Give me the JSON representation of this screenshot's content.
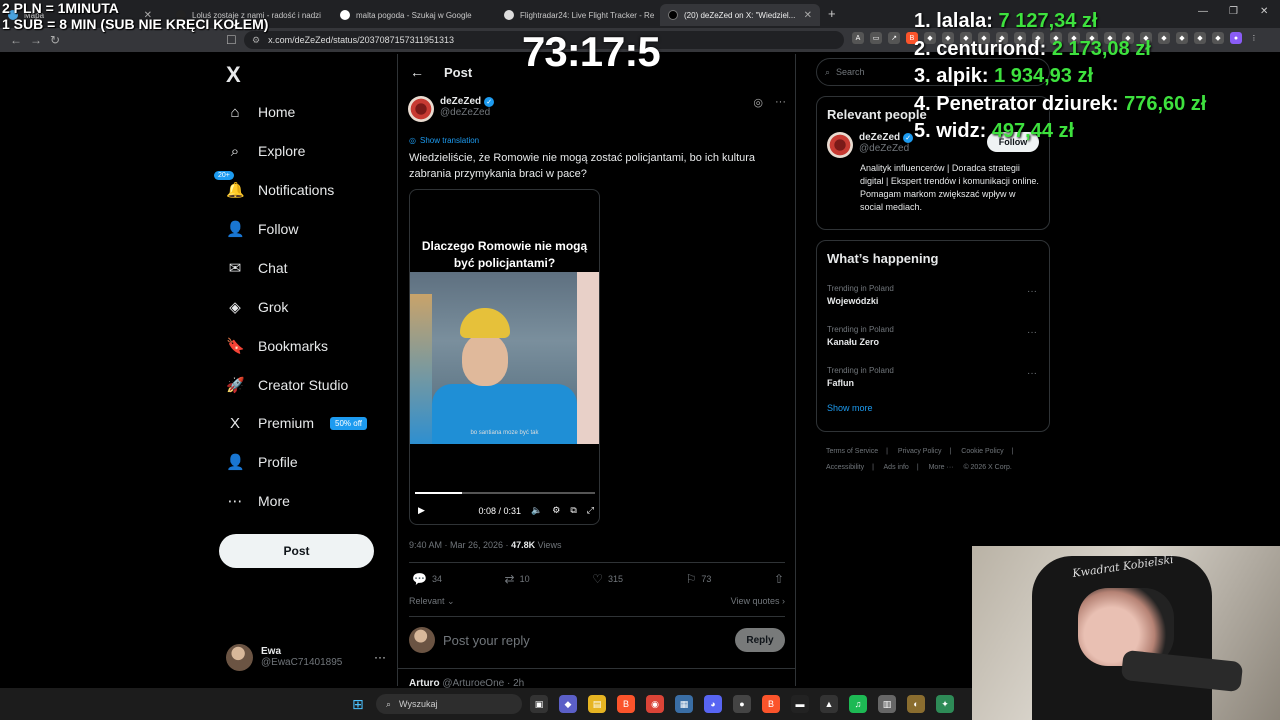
{
  "browser": {
    "tabs": [
      {
        "label": "Mapa",
        "color": "#4aa3df"
      },
      {
        "label": "Loluś zostaje z nami - radość i nadzi",
        "color": "#111111"
      },
      {
        "label": "malta pogoda - Szukaj w Google",
        "color": "#ffffff"
      },
      {
        "label": "Flightradar24: Live Flight Tracker - Re",
        "color": "#dddddd"
      },
      {
        "label": "(20) deZeZed on X: \"Wiedziel...",
        "color": "#000000"
      }
    ],
    "new_tab": "+",
    "url": "x.com/deZeZed/status/2037087157311951313"
  },
  "overlay": {
    "line1": "2 PLN = 1MINUTA",
    "line2": "1 SUB = 8 MIN (SUB NIE KRĘCI KOŁEM)",
    "timer": "73:17:5",
    "leaderboard": [
      {
        "rank": "1.",
        "name": "lalala:",
        "amount": "7 127,34 zł"
      },
      {
        "rank": "2.",
        "name": "centuriond:",
        "amount": "2 173,08 zł"
      },
      {
        "rank": "3.",
        "name": "alpik:",
        "amount": "1 934,93 zł"
      },
      {
        "rank": "4.",
        "name": "Penetrator dziurek:",
        "amount": "776,60 zł"
      },
      {
        "rank": "5.",
        "name": "widz:",
        "amount": "497,44 zł"
      }
    ],
    "webcam_shirt_text": "Kwadrat Kobielski"
  },
  "sidebar": {
    "logo": "X",
    "items": [
      {
        "label": "Home",
        "icon": "⌂"
      },
      {
        "label": "Explore",
        "icon": "⌕"
      },
      {
        "label": "Notifications",
        "icon": "🔔",
        "badge": "20+"
      },
      {
        "label": "Follow",
        "icon": "👤"
      },
      {
        "label": "Chat",
        "icon": "✉"
      },
      {
        "label": "Grok",
        "icon": "◈"
      },
      {
        "label": "Bookmarks",
        "icon": "🔖"
      },
      {
        "label": "Creator Studio",
        "icon": "🚀"
      },
      {
        "label": "Premium",
        "icon": "X",
        "badge": "50% off"
      },
      {
        "label": "Profile",
        "icon": "👤"
      },
      {
        "label": "More",
        "icon": "⋯"
      }
    ],
    "post_button": "Post",
    "account": {
      "name": "Ewa",
      "handle": "@EwaC71401895",
      "more": "···"
    }
  },
  "main": {
    "header": "Post",
    "author": {
      "name": "deZeZed",
      "handle": "@deZeZed"
    },
    "show_translation": "Show translation",
    "text": "Wiedzieliście, że Romowie nie mogą zostać policjantami, bo ich kultura zabrania przymykania braci w pace?",
    "video": {
      "title": "Dlaczego Romowie nie mogą być policjantami?",
      "subtitle": "bo santiana moze być tak",
      "time": "0:08 / 0:31",
      "progress": 0.26
    },
    "meta": {
      "time": "9:40 AM · Mar 26, 2026 · ",
      "views": "47.8K",
      "views_label": " Views"
    },
    "stats": {
      "replies": "34",
      "reposts": "10",
      "likes": "315",
      "bookmarks": "73"
    },
    "sort": "Relevant",
    "view_quotes": "View quotes",
    "reply_placeholder": "Post your reply",
    "reply_button": "Reply",
    "next_reply": {
      "name": "Arturo",
      "handle": "@ArturoeOne · 2h"
    }
  },
  "right": {
    "search_placeholder": "Search",
    "relevant": {
      "title": "Relevant people",
      "name": "deZeZed",
      "handle": "@deZeZed",
      "follow": "Follow",
      "bio": "Analityk influencerów | Doradca strategii digital | Ekspert trendów i komunikacji online. Pomagam markom zwiększać wpływ w social mediach."
    },
    "happening": {
      "title": "What’s happening",
      "trends": [
        {
          "meta": "Trending in Poland",
          "name": "Wojewódzki"
        },
        {
          "meta": "Trending in Poland",
          "name": "Kanału Zero"
        },
        {
          "meta": "Trending in Poland",
          "name": "Faflun"
        }
      ],
      "show_more": "Show more"
    },
    "footer": [
      "Terms of Service",
      "|",
      "Privacy Policy",
      "|",
      "Cookie Policy",
      "|",
      "Accessibility",
      "|",
      "Ads info",
      "|",
      "More ···",
      "© 2026 X Corp."
    ]
  },
  "taskbar": {
    "search": "Wyszukaj"
  }
}
